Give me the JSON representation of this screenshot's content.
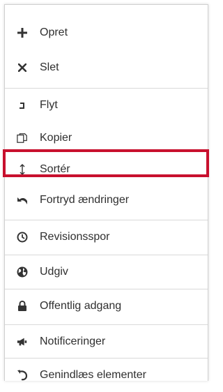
{
  "menu": {
    "items": [
      {
        "label": "Opret",
        "icon": "plus-icon"
      },
      {
        "label": "Slet",
        "icon": "close-icon"
      },
      {
        "label": "Flyt",
        "icon": "move-icon"
      },
      {
        "label": "Kopier",
        "icon": "copy-icon"
      },
      {
        "label": "Sortér",
        "icon": "sort-icon"
      },
      {
        "label": "Fortryd ændringer",
        "icon": "undo-icon"
      },
      {
        "label": "Revisionsspor",
        "icon": "clock-icon"
      },
      {
        "label": "Udgiv",
        "icon": "globe-icon"
      },
      {
        "label": "Offentlig adgang",
        "icon": "lock-icon"
      },
      {
        "label": "Notificeringer",
        "icon": "megaphone-icon"
      },
      {
        "label": "Genindlæs elementer",
        "icon": "reload-icon"
      }
    ],
    "highlighted_item": "Sortér",
    "highlight_color": "#c8102e"
  }
}
